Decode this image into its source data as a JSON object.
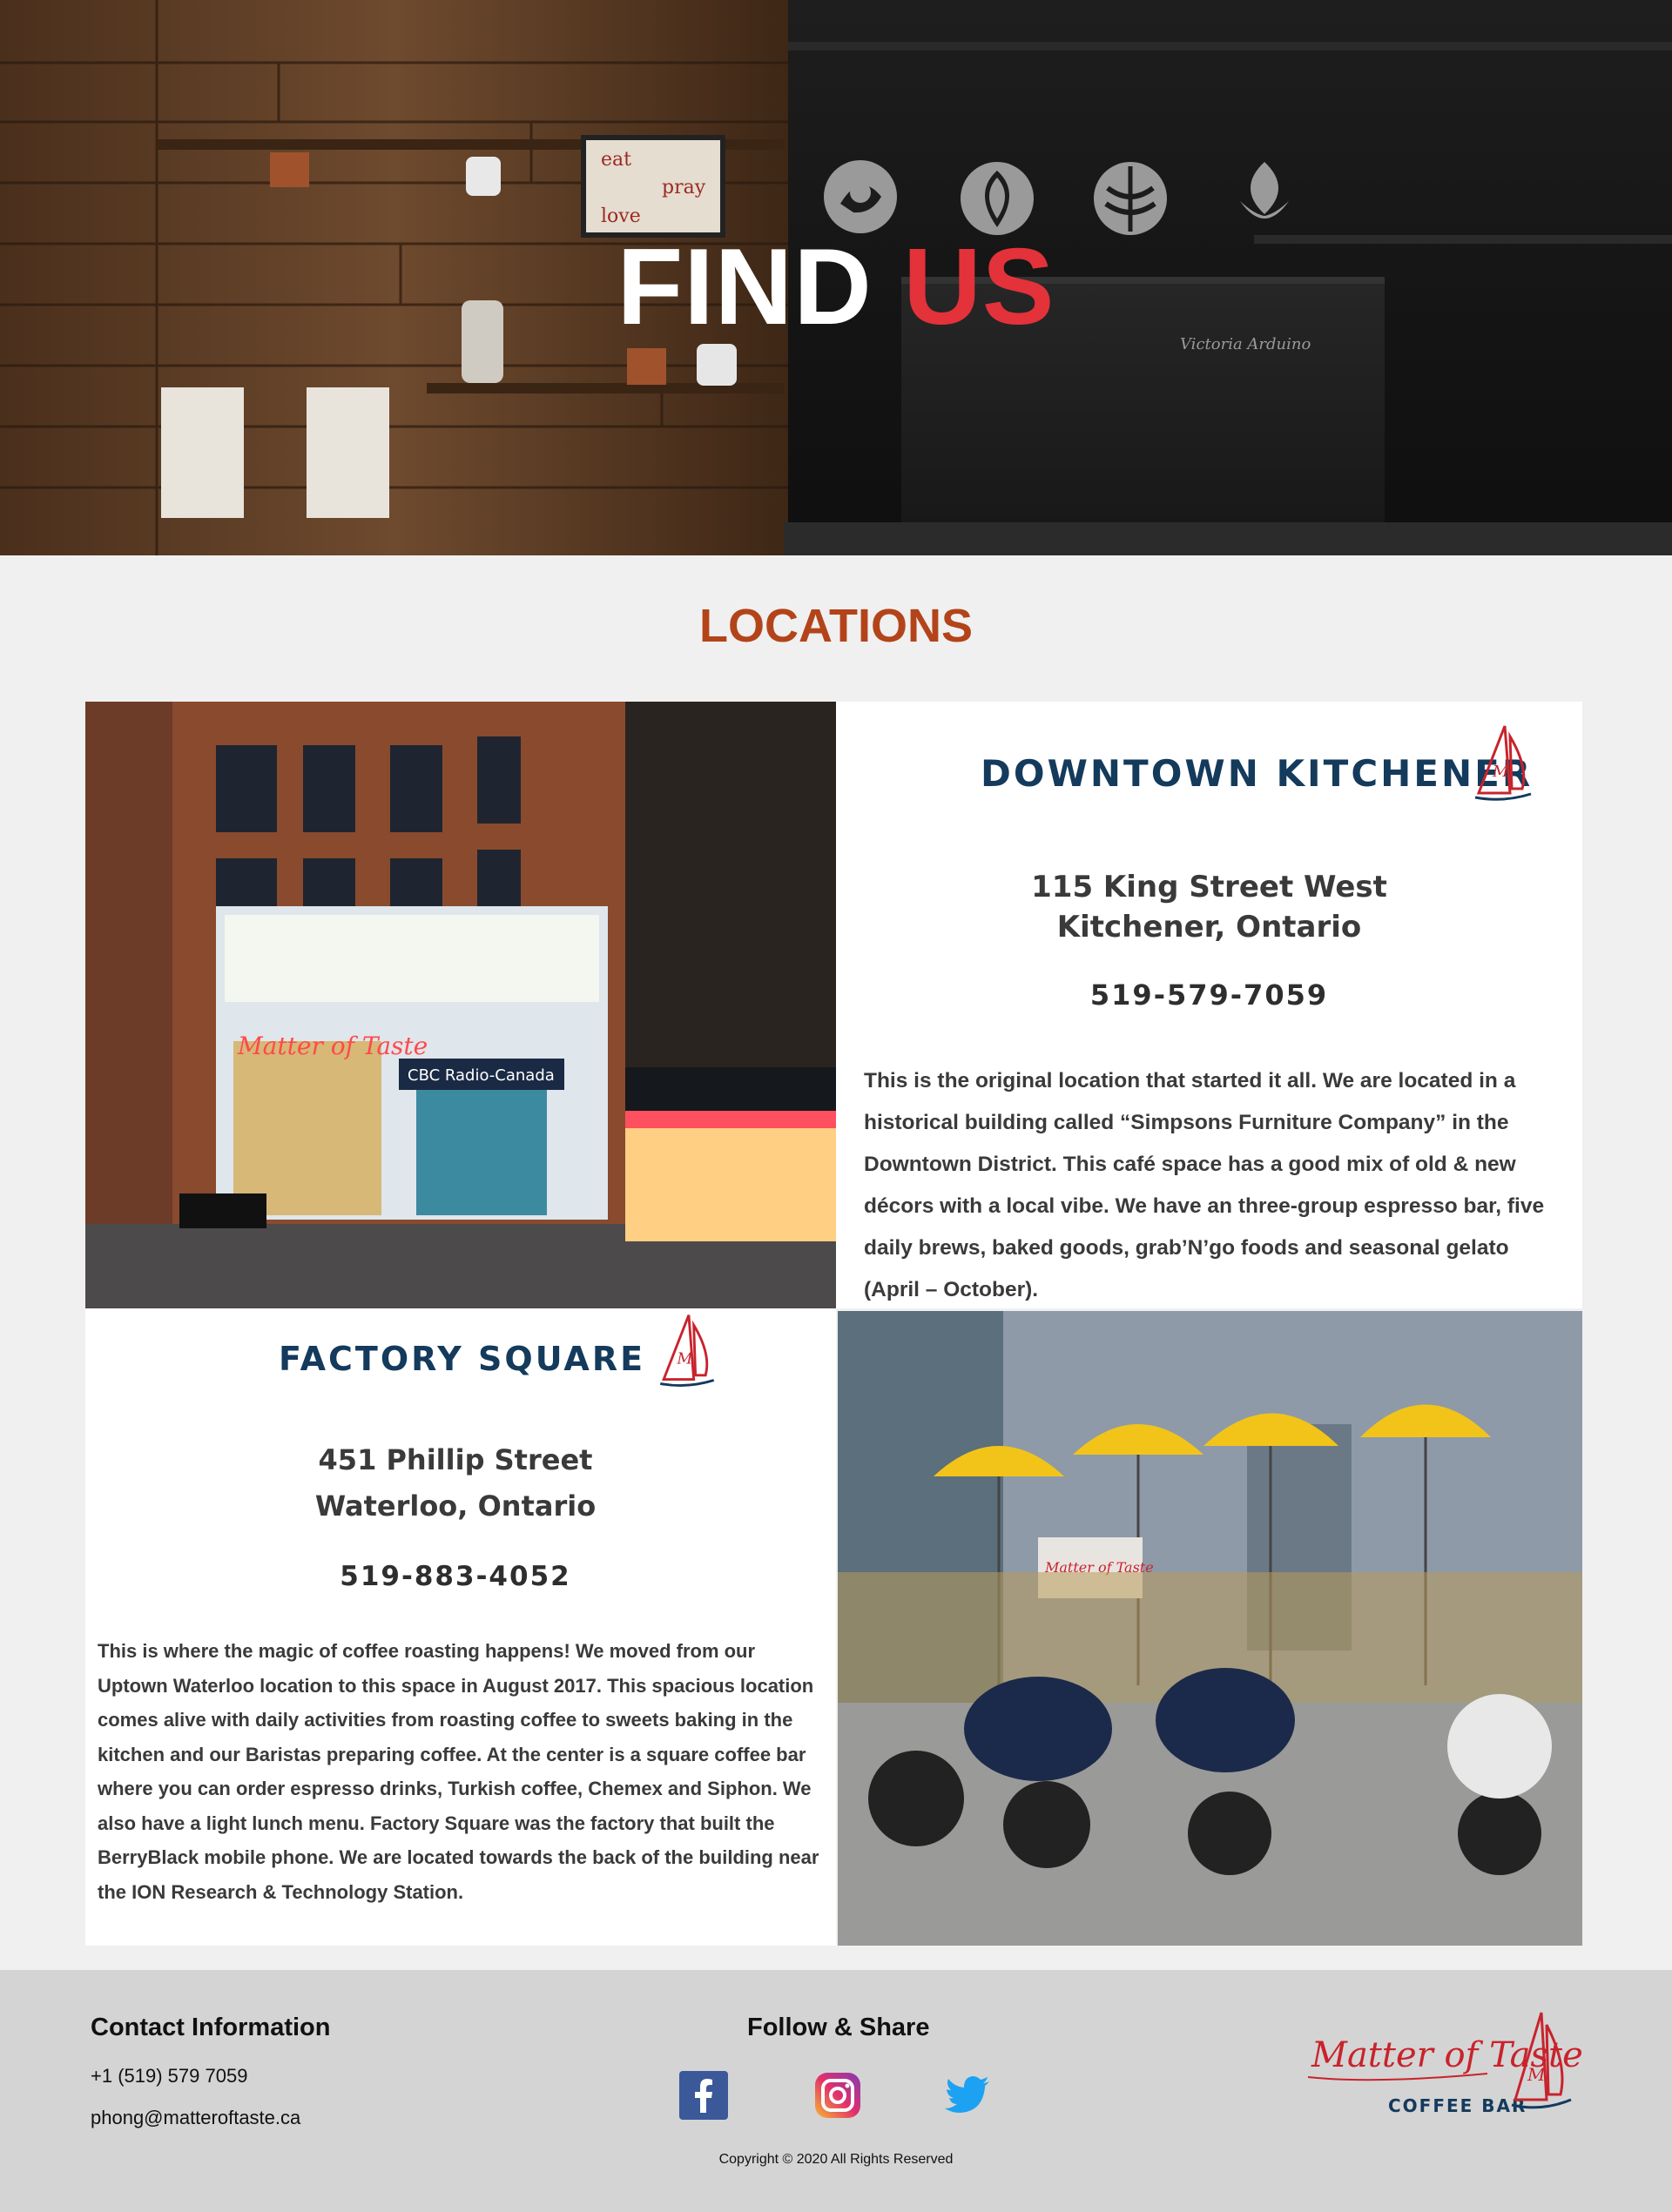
{
  "hero": {
    "title_white": "FIND",
    "title_red": "US",
    "machine_label": "Victoria Arduino"
  },
  "locations": {
    "title": "LOCATIONS",
    "kitchener": {
      "name": "DOWNTOWN KITCHENER",
      "address_line1": "115 King Street West",
      "address_line2": "Kitchener, Ontario",
      "phone": "519-579-7059",
      "description": "This is the original location that started it all. We are located in a historical building called “Simpsons Furniture Company”  in the Downtown District.  This café space has a good mix of old & new décors with a local vibe.  We have an three-group espresso bar, five daily brews, baked goods, grab’N’go foods and seasonal gelato (April – October).",
      "photo_signs": [
        "Matter of Taste",
        "CBC Radio-Canada"
      ]
    },
    "factory": {
      "name": "FACTORY SQUARE",
      "address_line1": "451 Phillip Street",
      "address_line2": "Waterloo, Ontario",
      "phone": "519-883-4052",
      "description": "This is where the magic of coffee roasting happens!  We moved from our Uptown Waterloo location to this space in August 2017. This spacious location comes alive with daily activities from roasting coffee to sweets baking in the kitchen and our Baristas preparing coffee. At the center is a square coffee bar where you can order espresso drinks, Turkish coffee, Chemex and Siphon. We also have a light lunch menu. Factory Square was the factory that built the BerryBlack mobile phone. We are located towards the back of the building near the ION Research & Technology Station.",
      "photo_sign": "Matter of Taste"
    }
  },
  "footer": {
    "contact_title": "Contact Information",
    "phone": "+1 (519) 579 7059",
    "email": "phong@matteroftaste.ca",
    "follow_title": "Follow & Share",
    "social": [
      "facebook-icon",
      "instagram-icon",
      "twitter-icon"
    ],
    "copyright": "Copyright © 2020 All Rights Reserved",
    "logo_script": "Matter of Taste",
    "logo_sub": "COFFEE BAR"
  },
  "colors": {
    "accent_red": "#e3323a",
    "section_orange": "#b3441a",
    "navy": "#143a5c",
    "footer_bg": "#d4d4d4"
  }
}
